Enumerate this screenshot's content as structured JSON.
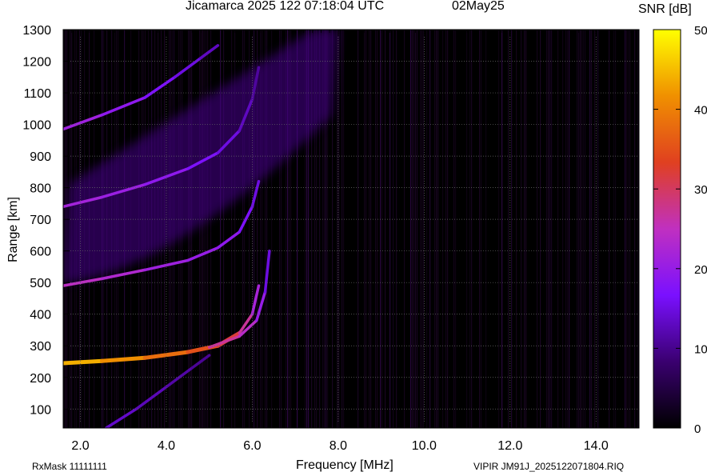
{
  "header": {
    "title": "Jicamarca 2025 122 07:18:04 UTC",
    "date": "02May25"
  },
  "footer": {
    "rxmask": "RxMask 11111111",
    "filename": "VIPIR  JM91J_2025122071804.RIQ"
  },
  "chart_data": {
    "type": "heatmap",
    "title": "Jicamarca 2025 122 07:18:04 UTC",
    "xlabel": "Frequency [MHz]",
    "ylabel": "Range [km]",
    "xlim": [
      1.6,
      15.0
    ],
    "ylim": [
      40,
      1300
    ],
    "x_ticks": [
      2.0,
      4.0,
      6.0,
      8.0,
      10.0,
      12.0,
      14.0
    ],
    "x_tick_labels": [
      "2.0",
      "4.0",
      "6.0",
      "8.0",
      "10.0",
      "12.0",
      "14.0"
    ],
    "y_ticks": [
      100,
      200,
      300,
      400,
      500,
      600,
      700,
      800,
      900,
      1000,
      1100,
      1200,
      1300
    ],
    "y_tick_labels": [
      "100",
      "200",
      "300",
      "400",
      "500",
      "600",
      "700",
      "800",
      "900",
      "1000",
      "1100",
      "1200",
      "1300"
    ],
    "grid": true,
    "colorbar": {
      "label": "SNR [dB]",
      "range": [
        0,
        50
      ],
      "ticks": [
        0,
        10,
        20,
        30,
        40,
        50
      ],
      "tick_labels": [
        "0",
        "10",
        "20",
        "30",
        "40",
        "50"
      ],
      "colors": [
        "#000000",
        "#3a0070",
        "#7a10ff",
        "#c030c0",
        "#e04020",
        "#f09000",
        "#ffff00"
      ]
    },
    "series": [
      {
        "trace": "o-first-hop",
        "freq": [
          1.6,
          2.5,
          3.5,
          4.5,
          5.2,
          5.7,
          6.0,
          6.15
        ],
        "range": [
          245,
          252,
          262,
          280,
          300,
          340,
          400,
          490
        ],
        "snr": [
          45,
          43,
          40,
          36,
          34,
          30,
          24,
          20
        ]
      },
      {
        "trace": "x-first-hop",
        "freq": [
          5.0,
          5.7,
          6.1,
          6.3,
          6.4
        ],
        "range": [
          295,
          330,
          380,
          470,
          600
        ],
        "snr": [
          28,
          26,
          22,
          18,
          12
        ]
      },
      {
        "trace": "second-hop",
        "freq": [
          1.6,
          2.5,
          3.5,
          4.5,
          5.2,
          5.7,
          6.0,
          6.15
        ],
        "range": [
          490,
          512,
          540,
          570,
          610,
          660,
          740,
          820
        ],
        "snr": [
          25,
          24,
          22,
          20,
          20,
          18,
          16,
          14
        ]
      },
      {
        "trace": "third-hop",
        "freq": [
          1.6,
          2.5,
          3.5,
          4.5,
          5.2,
          5.7,
          6.0,
          6.15
        ],
        "range": [
          740,
          770,
          810,
          860,
          910,
          980,
          1080,
          1180
        ],
        "snr": [
          22,
          21,
          20,
          18,
          16,
          14,
          12,
          10
        ]
      },
      {
        "trace": "fourth-hop",
        "freq": [
          1.6,
          2.5,
          3.5,
          4.2,
          4.8,
          5.2
        ],
        "range": [
          985,
          1030,
          1085,
          1150,
          1210,
          1250
        ],
        "snr": [
          22,
          20,
          18,
          16,
          14,
          12
        ]
      },
      {
        "trace": "low-range-echo",
        "freq": [
          2.6,
          3.3,
          4.0,
          4.6,
          5.0
        ],
        "range": [
          40,
          100,
          170,
          230,
          270
        ],
        "snr": [
          14,
          13,
          12,
          11,
          10
        ]
      },
      {
        "trace": "diffuse-spread",
        "freq": [
          1.6,
          8.0
        ],
        "range": [
          500,
          1050
        ],
        "snr": [
          10,
          8
        ]
      }
    ]
  }
}
